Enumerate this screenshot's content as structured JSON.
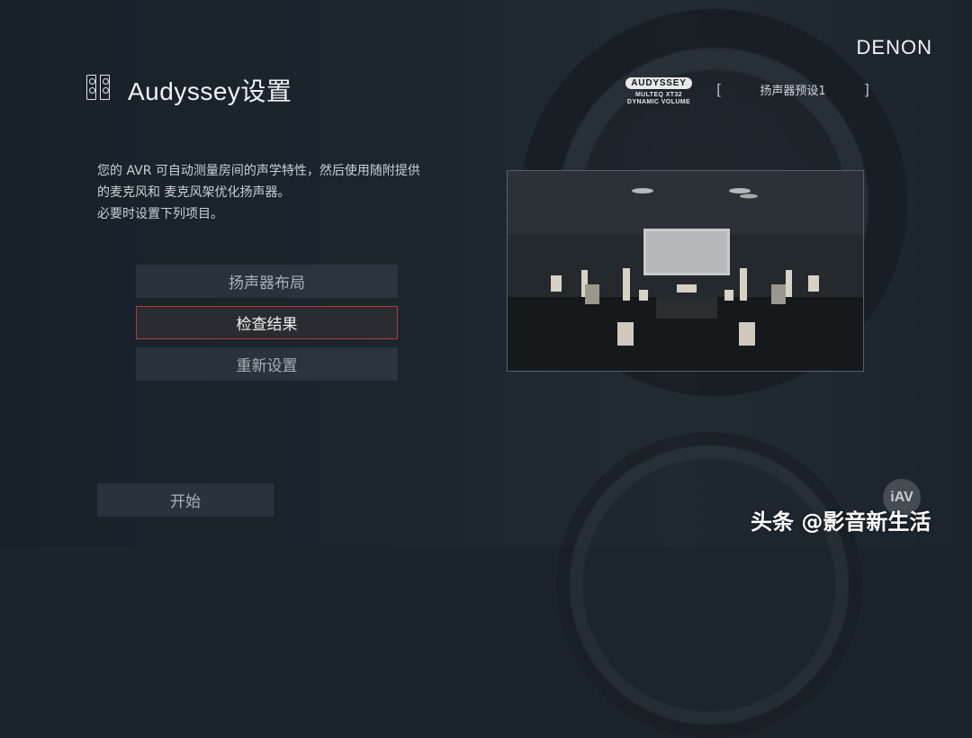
{
  "header": {
    "brand": "DENON",
    "title": "Audyssey设置",
    "logo": {
      "line1": "AUDYSSEY",
      "line2": "MULTEQ XT32",
      "line3": "DYNAMIC VOLUME"
    },
    "preset": {
      "open": "[",
      "label": "扬声器预设1",
      "close": "]"
    }
  },
  "description": {
    "line1": "您的 AVR 可自动测量房间的声学特性，然后使用随附提供",
    "line2": "的麦克风和 麦克风架优化扬声器。",
    "line3": "必要时设置下列项目。"
  },
  "menu": {
    "items": [
      {
        "label": "扬声器布局",
        "selected": false
      },
      {
        "label": "检查结果",
        "selected": true
      },
      {
        "label": "重新设置",
        "selected": false
      }
    ]
  },
  "start_button": {
    "label": "开始"
  },
  "watermark": {
    "text": "头条 @影音新生活",
    "badge": "iAV"
  },
  "icons": [
    "speaker-pair-icon"
  ],
  "colors": {
    "selected_border": "#b43a3a",
    "background": "#1b242c"
  }
}
